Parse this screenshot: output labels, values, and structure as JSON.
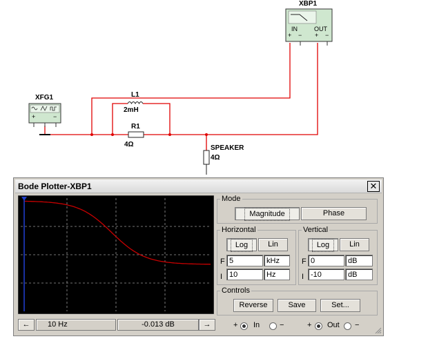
{
  "schematic": {
    "xfg_label": "XFG1",
    "xbp_label": "XBP1",
    "xbp_in": "IN",
    "xbp_out": "OUT",
    "l1_name": "L1",
    "l1_value": "2mH",
    "r1_name": "R1",
    "r1_value": "4Ω",
    "speaker_name": "SPEAKER",
    "speaker_value": "4Ω",
    "plus": "+",
    "minus": "−"
  },
  "window": {
    "title": "Bode Plotter-XBP1",
    "close_glyph": "✕"
  },
  "colors": {
    "wire": "#e00000",
    "curve": "#c80000",
    "cursor": "#1e3cc8",
    "screen": "#000000"
  },
  "plot": {
    "x_axis": "log",
    "y_axis": "log",
    "grid": "dashed"
  },
  "mode": {
    "label": "Mode",
    "magnitude": "Magnitude",
    "phase": "Phase",
    "selected": "Magnitude"
  },
  "horizontal": {
    "label": "Horizontal",
    "log": "Log",
    "lin": "Lin",
    "selected": "Log",
    "f_label": "F",
    "f_value": "5",
    "f_unit": "kHz",
    "i_label": "I",
    "i_value": "10",
    "i_unit": "Hz"
  },
  "vertical": {
    "label": "Vertical",
    "log": "Log",
    "lin": "Lin",
    "selected": "Log",
    "f_label": "F",
    "f_value": "0",
    "f_unit": "dB",
    "i_label": "I",
    "i_value": "-10",
    "i_unit": "dB"
  },
  "controls": {
    "label": "Controls",
    "reverse": "Reverse",
    "save": "Save",
    "set": "Set..."
  },
  "status": {
    "left_arrow": "←",
    "right_arrow": "→",
    "frequency": "10  Hz",
    "magnitude": "-0.013 dB",
    "in_label": "In",
    "out_label": "Out",
    "plus": "+",
    "minus": "−"
  }
}
